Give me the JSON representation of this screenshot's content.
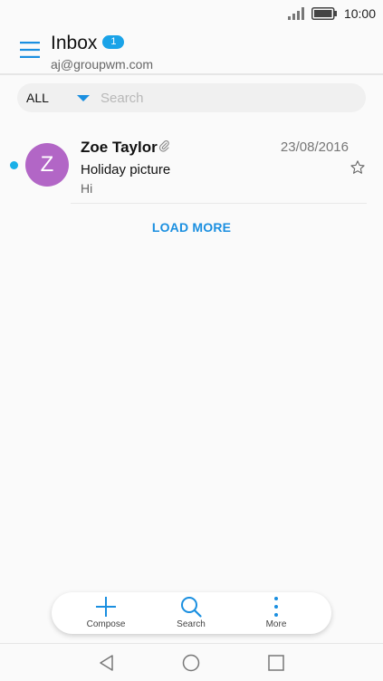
{
  "status": {
    "time": "10:00"
  },
  "header": {
    "title": "Inbox",
    "badge": "1",
    "account": "aj@groupwm.com"
  },
  "filter": {
    "selected": "ALL",
    "search_placeholder": "Search"
  },
  "emails": [
    {
      "sender": "Zoe Taylor",
      "initial": "Z",
      "date": "23/08/2016",
      "subject": "Holiday picture",
      "preview": "Hi",
      "unread": true,
      "has_attachment": true,
      "avatar_color": "#b266c6"
    }
  ],
  "load_more_label": "LOAD MORE",
  "toolbar": {
    "compose_label": "Compose",
    "search_label": "Search",
    "more_label": "More"
  },
  "colors": {
    "accent": "#1a8fe0",
    "unread_dot": "#1ab0e8",
    "badge": "#1aa3e8"
  }
}
